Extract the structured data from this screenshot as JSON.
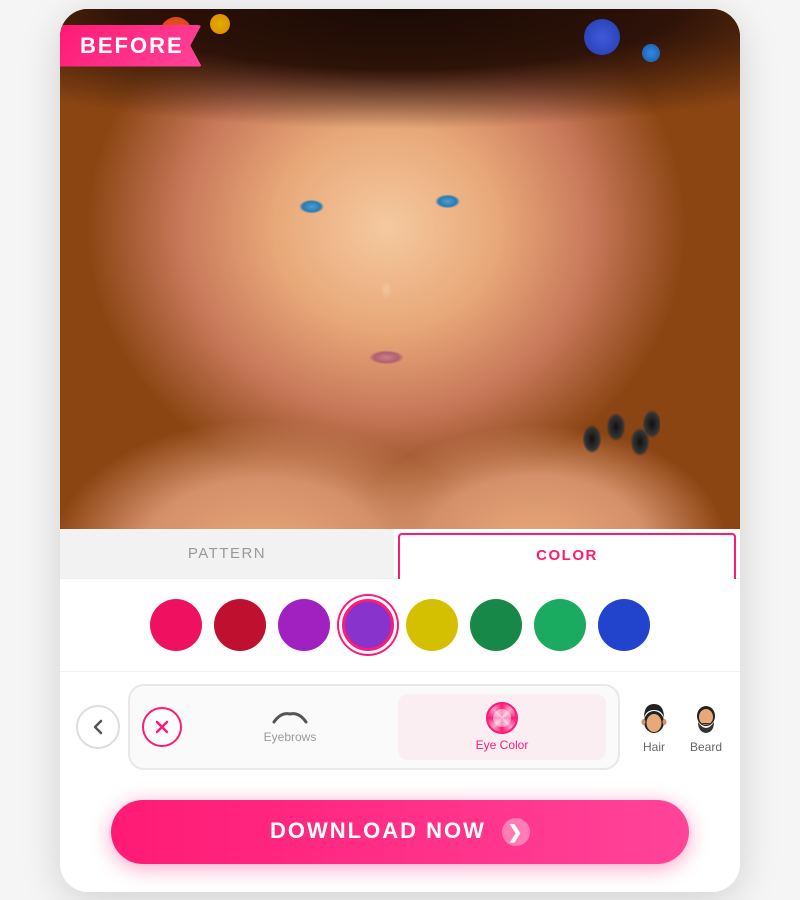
{
  "app": {
    "before_label": "BEFORE"
  },
  "tabs": {
    "pattern": {
      "label": "PATTERN",
      "active": false
    },
    "color": {
      "label": "COLOR",
      "active": true
    }
  },
  "colors": [
    {
      "id": "hot-pink",
      "hex": "#f01060",
      "selected": false
    },
    {
      "id": "crimson",
      "hex": "#c01030",
      "selected": false
    },
    {
      "id": "purple",
      "hex": "#a020c0",
      "selected": false
    },
    {
      "id": "violet",
      "hex": "#8833cc",
      "selected": true
    },
    {
      "id": "yellow",
      "hex": "#d4c000",
      "selected": false
    },
    {
      "id": "green",
      "hex": "#188848",
      "selected": false
    },
    {
      "id": "teal-green",
      "hex": "#1aaa60",
      "selected": false
    },
    {
      "id": "blue",
      "hex": "#2244cc",
      "selected": false
    }
  ],
  "tools": {
    "eyebrows": {
      "label": "Eyebrows",
      "active": false
    },
    "eye_color": {
      "label": "Eye Color",
      "active": true
    },
    "hair": {
      "label": "Hair",
      "active": false
    },
    "beard": {
      "label": "Beard",
      "active": false
    }
  },
  "download_button": {
    "label": "DOWNLOAD NOW"
  },
  "bokeh": [
    {
      "id": "b1",
      "color": "#ff4500"
    },
    {
      "id": "b2",
      "color": "#ffcc00"
    },
    {
      "id": "b3",
      "color": "#3355ff"
    },
    {
      "id": "b4",
      "color": "#2288ff"
    }
  ]
}
